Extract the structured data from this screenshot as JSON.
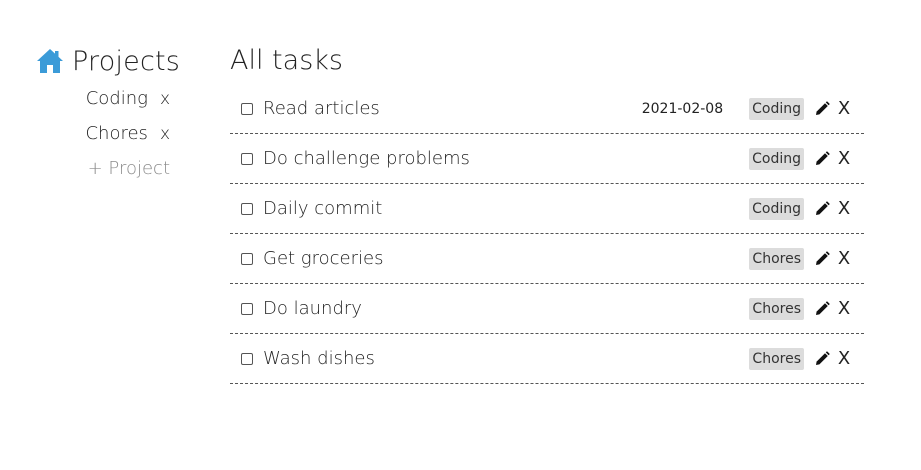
{
  "sidebar": {
    "title": "Projects",
    "projects": [
      {
        "name": "Coding",
        "remove_label": "x"
      },
      {
        "name": "Chores",
        "remove_label": "x"
      }
    ],
    "add_project_label": "+ Project",
    "icon": "home-icon",
    "icon_color": "#3b9bd8"
  },
  "main": {
    "title": "All tasks",
    "tasks": [
      {
        "name": "Read articles",
        "date": "2021-02-08",
        "tag": "Coding",
        "delete_label": "X"
      },
      {
        "name": "Do challenge problems",
        "date": "",
        "tag": "Coding",
        "delete_label": "X"
      },
      {
        "name": "Daily commit",
        "date": "",
        "tag": "Coding",
        "delete_label": "X"
      },
      {
        "name": "Get groceries",
        "date": "",
        "tag": "Chores",
        "delete_label": "X"
      },
      {
        "name": "Do laundry",
        "date": "",
        "tag": "Chores",
        "delete_label": "X"
      },
      {
        "name": "Wash dishes",
        "date": "",
        "tag": "Chores",
        "delete_label": "X"
      }
    ]
  }
}
